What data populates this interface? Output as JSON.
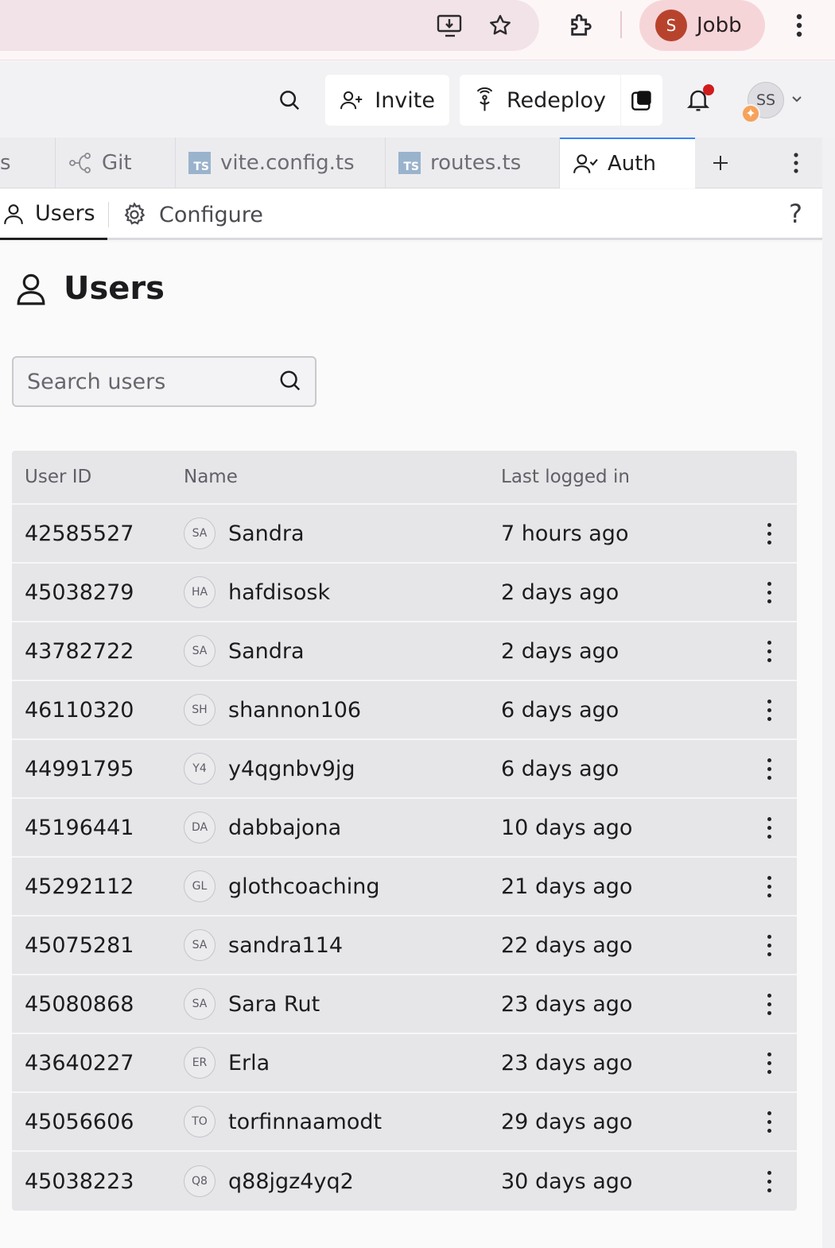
{
  "browser": {
    "profile_initial": "S",
    "profile_name": "Jobb"
  },
  "header": {
    "invite_label": "Invite",
    "redeploy_label": "Redeploy",
    "user_initials": "SS"
  },
  "tabs": [
    {
      "label": "s"
    },
    {
      "label": "Git"
    },
    {
      "label": "vite.config.ts"
    },
    {
      "label": "routes.ts"
    },
    {
      "label": "Auth"
    }
  ],
  "ts_badge": "TS",
  "subtabs": {
    "users": "Users",
    "configure": "Configure",
    "help": "?"
  },
  "page": {
    "title": "Users",
    "search_placeholder": "Search users"
  },
  "table": {
    "columns": {
      "user_id": "User ID",
      "name": "Name",
      "last_logged_in": "Last logged in"
    },
    "rows": [
      {
        "id": "42585527",
        "initials": "SA",
        "name": "Sandra",
        "last": "7 hours ago"
      },
      {
        "id": "45038279",
        "initials": "HA",
        "name": "hafdisosk",
        "last": "2 days ago"
      },
      {
        "id": "43782722",
        "initials": "SA",
        "name": "Sandra",
        "last": "2 days ago"
      },
      {
        "id": "46110320",
        "initials": "SH",
        "name": "shannon106",
        "last": "6 days ago"
      },
      {
        "id": "44991795",
        "initials": "Y4",
        "name": "y4qgnbv9jg",
        "last": "6 days ago"
      },
      {
        "id": "45196441",
        "initials": "DA",
        "name": "dabbajona",
        "last": "10 days ago"
      },
      {
        "id": "45292112",
        "initials": "GL",
        "name": "glothcoaching",
        "last": "21 days ago"
      },
      {
        "id": "45075281",
        "initials": "SA",
        "name": "sandra114",
        "last": "22 days ago"
      },
      {
        "id": "45080868",
        "initials": "SA",
        "name": "Sara Rut",
        "last": "23 days ago"
      },
      {
        "id": "43640227",
        "initials": "ER",
        "name": "Erla",
        "last": "23 days ago"
      },
      {
        "id": "45056606",
        "initials": "TO",
        "name": "torfinnaamodt",
        "last": "29 days ago"
      },
      {
        "id": "45038223",
        "initials": "Q8",
        "name": "q88jgz4yq2",
        "last": "30 days ago"
      }
    ]
  },
  "colors": {
    "profile_avatar": "#b8432d",
    "notification_dot": "#d11c1c",
    "active_tab_accent": "#3b82f6",
    "avatar_badge": "#f7a25a"
  }
}
